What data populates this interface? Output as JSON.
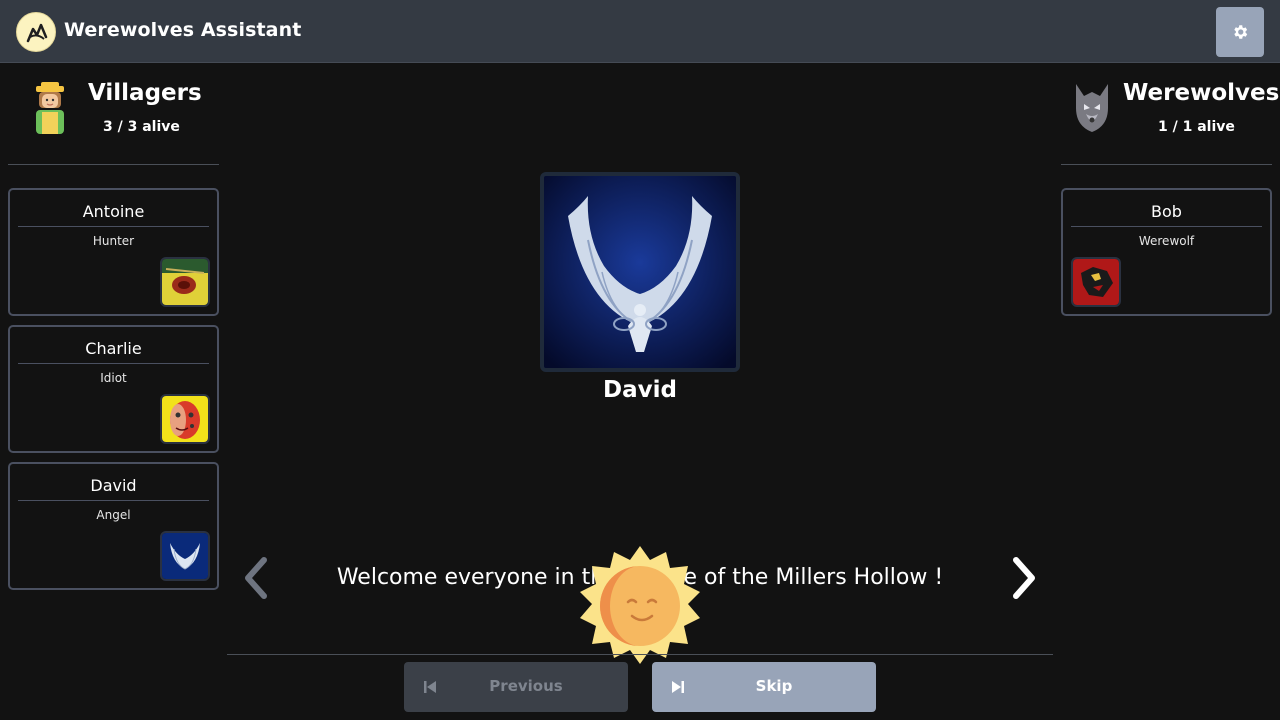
{
  "app": {
    "title": "Werewolves Assistant",
    "settings_icon": "gear-icon"
  },
  "villagers": {
    "name": "Villagers",
    "alive": "3 / 3 alive",
    "players": [
      {
        "name": "Antoine",
        "role": "Hunter",
        "icon": "hunter-role-icon"
      },
      {
        "name": "Charlie",
        "role": "Idiot",
        "icon": "idiot-role-icon"
      },
      {
        "name": "David",
        "role": "Angel",
        "icon": "angel-role-icon"
      }
    ]
  },
  "werewolves": {
    "name": "Werewolves",
    "alive": "1 / 1 alive",
    "players": [
      {
        "name": "Bob",
        "role": "Werewolf",
        "icon": "werewolf-role-icon"
      }
    ]
  },
  "center": {
    "current_player": "David",
    "current_role_icon": "angel-wings-icon",
    "message": "Welcome everyone in the village of the Millers Hollow !",
    "phase_icon": "sun-icon"
  },
  "controls": {
    "previous_label": "Previous",
    "skip_label": "Skip",
    "previous_enabled": false
  },
  "colors": {
    "header_bg": "#343a43",
    "page_bg": "#121212",
    "accent": "#98a4b8",
    "card_border": "#4a5060",
    "sun": "#fde68a"
  }
}
